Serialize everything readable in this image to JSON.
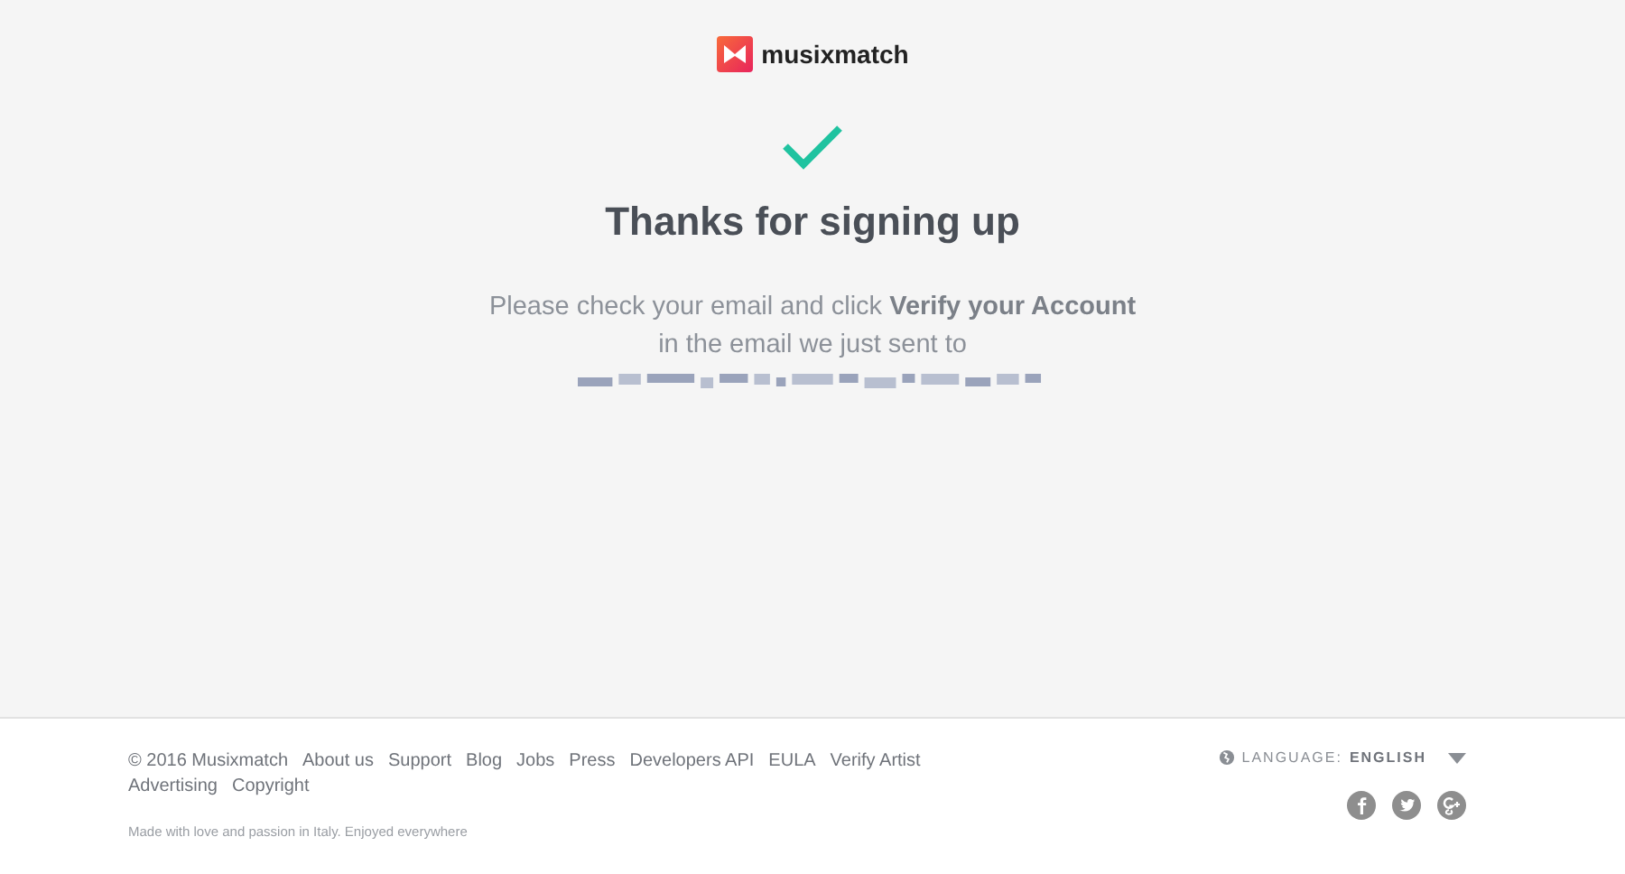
{
  "logo": {
    "name": "musixmatch"
  },
  "message": {
    "title": "Thanks for signing up",
    "body": "Please check your email and click **Verify your Account** in the email we just sent to"
  },
  "footer": {
    "copyright": "© 2016 Musixmatch",
    "links": [
      "About us",
      "Support",
      "Blog",
      "Jobs",
      "Press",
      "Developers API",
      "EULA",
      "Verify Artist",
      "Advertising",
      "Copyright"
    ],
    "tagline": "Made with love and passion in Italy. Enjoyed everywhere",
    "language": {
      "label": "LANGUAGE:",
      "value": "ENGLISH"
    }
  }
}
